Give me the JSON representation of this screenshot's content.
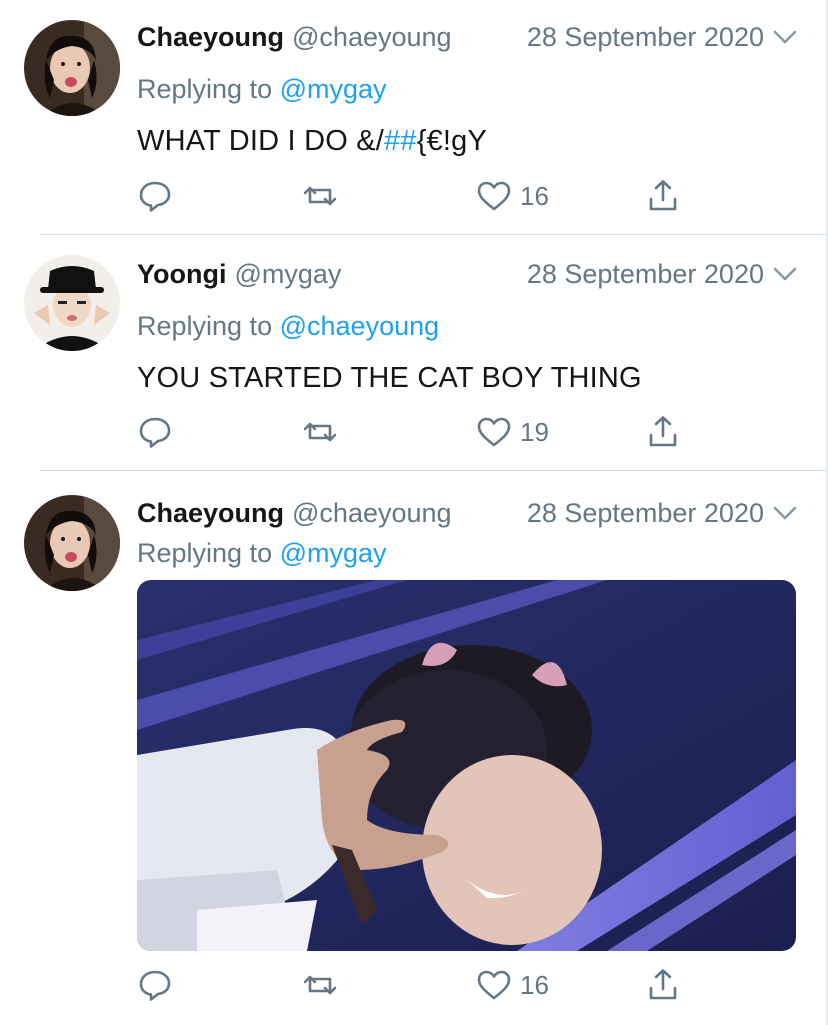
{
  "tweets": [
    {
      "name": "Chaeyoung",
      "handle": "@chaeyoung",
      "date": "28 September 2020",
      "replying_prefix": "Replying to",
      "replying_to": "@mygay",
      "text_before": "WHAT DID I DO &/",
      "text_tag": "##",
      "text_after": "{€!gY",
      "like_count": "16"
    },
    {
      "name": "Yoongi",
      "handle": "@mygay",
      "date": "28 September 2020",
      "replying_prefix": "Replying to",
      "replying_to": "@chaeyoung",
      "text": "YOU STARTED THE CAT BOY THING",
      "like_count": "19"
    },
    {
      "name": "Chaeyoung",
      "handle": "@chaeyoung",
      "date": "28 September 2020",
      "replying_prefix": "Replying to",
      "replying_to": "@mygay",
      "like_count": "16"
    }
  ],
  "colors": {
    "link": "#1da1f2",
    "secondary_text": "#657786",
    "primary_text": "#14171a",
    "divider": "#d8dde1"
  },
  "icons": [
    "reply-icon",
    "retweet-icon",
    "like-icon",
    "share-icon",
    "chevron-down-icon"
  ]
}
